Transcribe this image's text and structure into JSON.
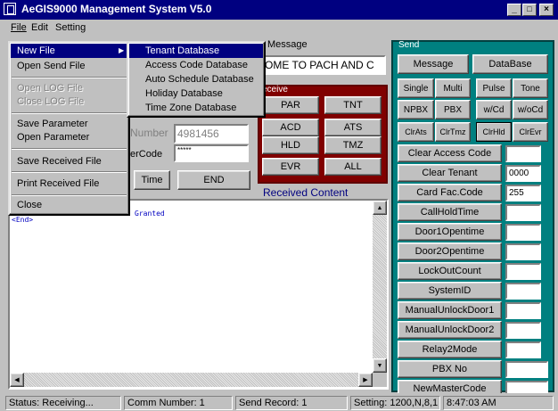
{
  "window": {
    "title": "AeGIS9000 Management System V5.0",
    "min": "_",
    "max": "□",
    "close": "×"
  },
  "menubar": {
    "file": "File",
    "edit": "Edit",
    "setting": "Setting"
  },
  "file_menu": {
    "new_file": "New File",
    "open_send_file": "Open Send File",
    "open_log_file": "Open LOG File",
    "close_log_file": "Close LOG File",
    "save_parameter": "Save Parameter",
    "open_parameter": "Open Parameter",
    "save_received_file": "Save Received File",
    "print_received_file": "Print Received File",
    "close": "Close"
  },
  "new_file_submenu": {
    "tenant_db": "Tenant Database",
    "access_code_db": "Access Code Database",
    "auto_schedule_db": "Auto Schedule Database",
    "holiday_db": "Holiday Database",
    "time_zone_db": "Time Zone Database"
  },
  "message": {
    "label": "Message",
    "value": "OME TO PACH AND C"
  },
  "number": {
    "label": "Number",
    "value": "4981456"
  },
  "usercode": {
    "label": "erCode",
    "value": "*****"
  },
  "buttons": {
    "time": "Time",
    "end": "END"
  },
  "receive": {
    "label": "eceive",
    "buttons": [
      "PAR",
      "TNT",
      "ACD",
      "ATS",
      "HLD",
      "TMZ",
      "EVR",
      "ALL"
    ]
  },
  "received_content": {
    "label": "Received Content",
    "lines": [
      "Granted",
      "<End>"
    ]
  },
  "send": {
    "label": "Send",
    "message": "Message",
    "database": "DataBase",
    "row1": [
      "Single",
      "Multi",
      "Pulse",
      "Tone"
    ],
    "row2": [
      "NPBX",
      "PBX",
      "w/Cd",
      "w/oCd"
    ],
    "row3": [
      "ClrAts",
      "ClrTmz",
      "ClrHld",
      "ClrEvr"
    ],
    "commands": [
      {
        "label": "Clear Access Code",
        "value": ""
      },
      {
        "label": "Clear Tenant",
        "value": "0000"
      },
      {
        "label": "Card Fac.Code",
        "value": "255"
      },
      {
        "label": "CallHoldTime",
        "value": ""
      },
      {
        "label": "Door1Opentime",
        "value": ""
      },
      {
        "label": "Door2Opentime",
        "value": ""
      },
      {
        "label": "LockOutCount",
        "value": ""
      },
      {
        "label": "SystemID",
        "value": ""
      },
      {
        "label": "ManualUnlockDoor1",
        "value": ""
      },
      {
        "label": "ManualUnlockDoor2",
        "value": ""
      },
      {
        "label": "Relay2Mode",
        "value": ""
      },
      {
        "label": "PBX  No",
        "value": ""
      },
      {
        "label": "NewMasterCode",
        "value": ""
      }
    ]
  },
  "status": {
    "state": "Status: Receiving...",
    "comm": "Comm Number:  1",
    "record": "Send Record:  1",
    "setting": "Setting: 1200,N,8,1",
    "time": "8:47:03 AM"
  },
  "icons": [
    "app-icon",
    "minimize-icon",
    "maximize-icon",
    "close-icon",
    "submenu-arrow-icon",
    "scroll-up-icon",
    "scroll-down-icon",
    "scroll-left-icon",
    "scroll-right-icon"
  ]
}
